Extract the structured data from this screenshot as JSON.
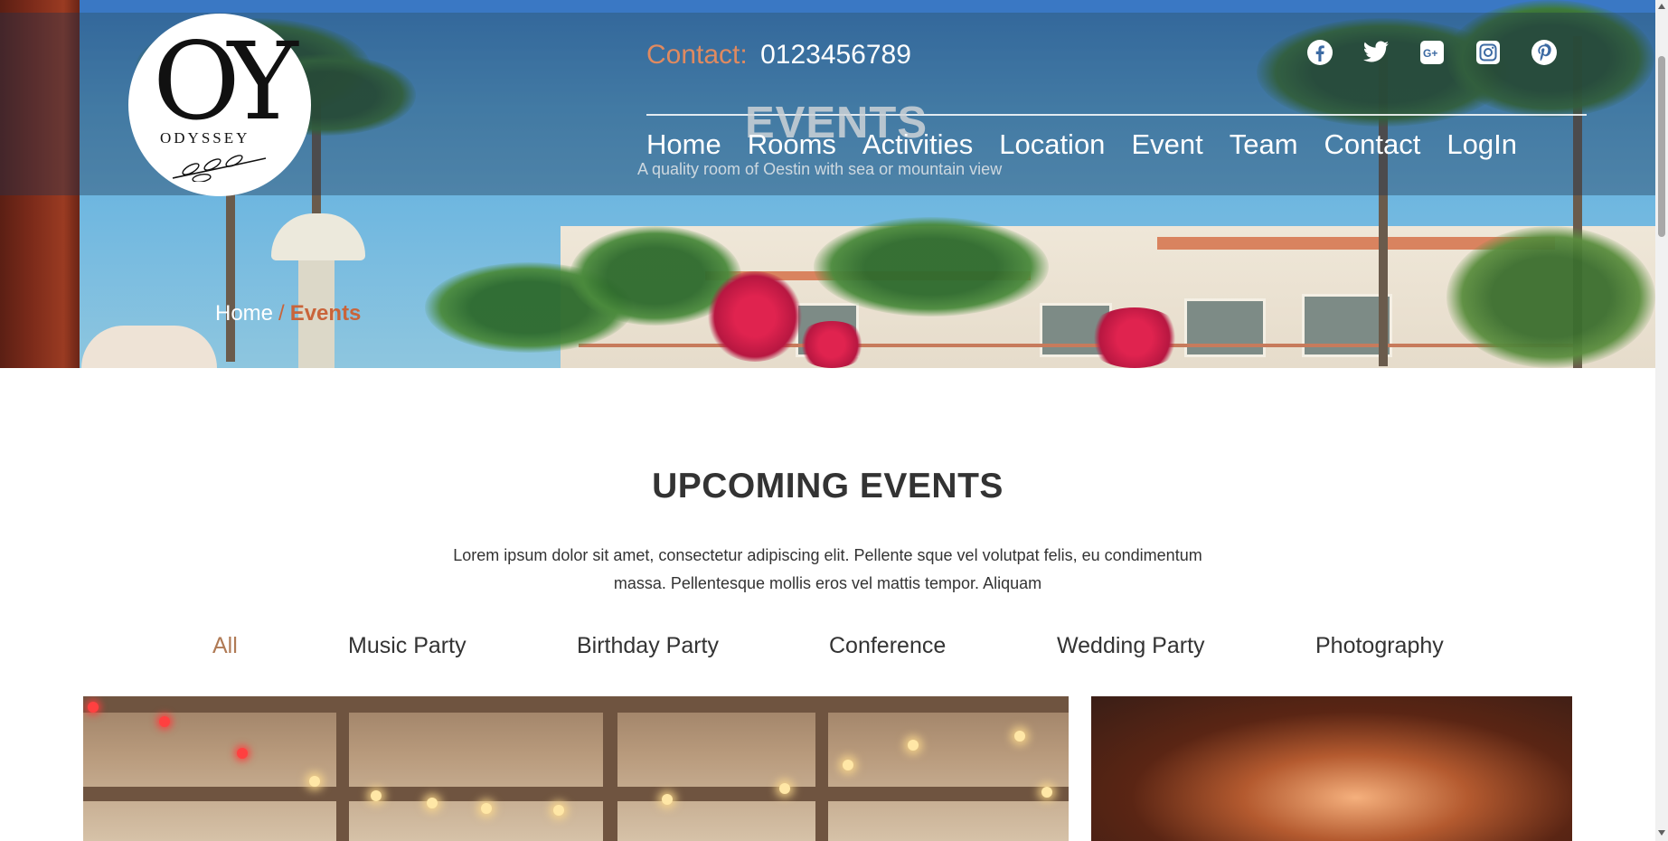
{
  "brand": {
    "logo_monogram": "OY",
    "logo_word": "ODYSSEY"
  },
  "header": {
    "contact_label": "Contact:",
    "contact_number": "0123456789",
    "socials": [
      "facebook-icon",
      "twitter-icon",
      "google-plus-icon",
      "instagram-icon",
      "pinterest-icon"
    ],
    "nav": [
      "Home",
      "Rooms",
      "Activities",
      "Location",
      "Event",
      "Team",
      "Contact",
      "LogIn"
    ]
  },
  "hero": {
    "title": "EVENTS",
    "subtitle": "A quality room of Oestin with sea or mountain view",
    "breadcrumb": {
      "home": "Home",
      "separator": "/",
      "current": "Events"
    }
  },
  "section": {
    "title": "UPCOMING EVENTS",
    "description": "Lorem ipsum dolor sit amet, consectetur adipiscing elit. Pellente sque vel volutpat felis, eu condimentum massa. Pellentesque mollis eros vel mattis tempor. Aliquam",
    "filters": [
      "All",
      "Music Party",
      "Birthday Party",
      "Conference",
      "Wedding Party",
      "Photography"
    ],
    "active_filter": "All"
  },
  "colors": {
    "accent": "#c9643a",
    "filter_active": "#b07a55",
    "contact_label": "#e08a60",
    "text_dark": "#333333"
  }
}
